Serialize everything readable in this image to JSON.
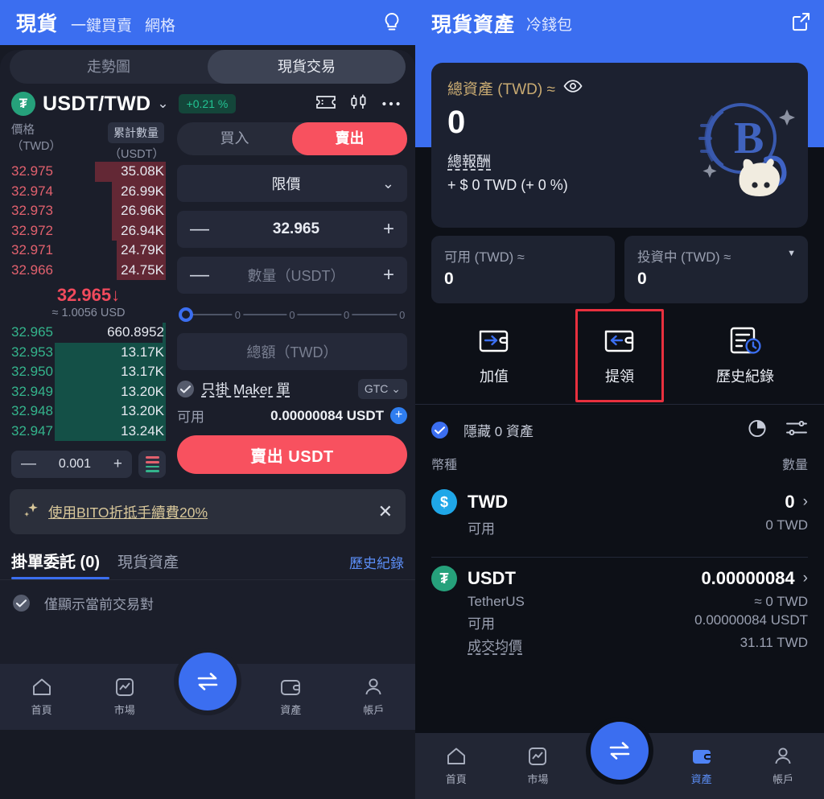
{
  "left": {
    "topbar": {
      "active_tab": "現貨",
      "tabs": [
        "一鍵買賣",
        "網格"
      ],
      "bulb_icon": "lightbulb-icon"
    },
    "segment": {
      "inactive": "走勢圖",
      "active": "現貨交易"
    },
    "pair": {
      "coin_symbol": "₮",
      "name": "USDT/TWD",
      "caret": "⌄",
      "change": "+0.21 %",
      "icons": [
        "ticket-icon",
        "candlestick-icon",
        "more-icon"
      ]
    },
    "orderbook": {
      "head_price": "價格",
      "head_price_unit": "（TWD）",
      "head_qty": "累計數量",
      "head_qty_unit": "（USDT）",
      "asks": [
        {
          "price": "32.975",
          "amount": "35.08K",
          "depth": 46
        },
        {
          "price": "32.974",
          "amount": "26.99K",
          "depth": 35
        },
        {
          "price": "32.973",
          "amount": "26.96K",
          "depth": 35
        },
        {
          "price": "32.972",
          "amount": "26.94K",
          "depth": 35
        },
        {
          "price": "32.971",
          "amount": "24.79K",
          "depth": 32
        },
        {
          "price": "32.966",
          "amount": "24.75K",
          "depth": 32
        }
      ],
      "mid_price": "32.965",
      "mid_arrow": "↓",
      "mid_usd": "≈ 1.0056 USD",
      "bids": [
        {
          "price": "32.965",
          "amount": "660.8952",
          "depth": 2
        },
        {
          "price": "32.953",
          "amount": "13.17K",
          "depth": 72
        },
        {
          "price": "32.950",
          "amount": "13.17K",
          "depth": 72
        },
        {
          "price": "32.949",
          "amount": "13.20K",
          "depth": 72
        },
        {
          "price": "32.948",
          "amount": "13.20K",
          "depth": 72
        },
        {
          "price": "32.947",
          "amount": "13.24K",
          "depth": 72
        }
      ],
      "tick_minus": "—",
      "tick_value": "0.001",
      "tick_plus": "+",
      "depth_icon": "orderbook-layout-icon"
    },
    "form": {
      "buy_tab": "買入",
      "sell_tab": "賣出",
      "order_type": "限價",
      "order_type_caret": "⌄",
      "price_minus": "—",
      "price_value": "32.965",
      "price_plus": "+",
      "qty_minus": "—",
      "qty_placeholder": "數量（USDT）",
      "qty_plus": "+",
      "slider_ticks": [
        "0",
        "0",
        "0",
        "0"
      ],
      "total_placeholder": "總額（TWD）",
      "maker_label": "只掛 Maker 單",
      "maker_checked": true,
      "tif": "GTC",
      "tif_caret": "⌄",
      "avail_label": "可用",
      "avail_value": "0.00000084 USDT",
      "plus_label": "+",
      "submit_label": "賣出 USDT"
    },
    "promo": {
      "icon": "sparkle-icon",
      "text": "使用BITO折抵手續費20%",
      "close": "✕"
    },
    "tabs": {
      "orders": "掛單委託 (0)",
      "spot": "現貨資產",
      "history": "歷史紀錄"
    },
    "filter": {
      "label": "僅顯示當前交易對",
      "checked": true
    },
    "bottom_nav": [
      {
        "icon": "home-icon",
        "label": "首頁",
        "active": false
      },
      {
        "icon": "market-chart-icon",
        "label": "市場",
        "active": false
      },
      {
        "icon": "swap-icon",
        "label": "",
        "active": false
      },
      {
        "icon": "wallet-icon",
        "label": "資產",
        "active": false
      },
      {
        "icon": "account-icon",
        "label": "帳戶",
        "active": false
      }
    ]
  },
  "right": {
    "topbar": {
      "title": "現貨資產",
      "sub": "冷錢包",
      "external_icon": "external-link-icon"
    },
    "total_card": {
      "label": "總資產 (TWD) ≈",
      "eye_icon": "eye-icon",
      "amount": "0",
      "reward_label": "總報酬",
      "reward_value": "+ $ 0 TWD (+ 0 %)"
    },
    "minis": [
      {
        "label": "可用 (TWD) ≈",
        "value": "0",
        "caret": ""
      },
      {
        "label": "投資中 (TWD) ≈",
        "value": "0",
        "caret": "▼"
      }
    ],
    "actions": [
      {
        "icon": "wallet-deposit-icon",
        "label": "加值",
        "highlighted": false
      },
      {
        "icon": "wallet-withdraw-icon",
        "label": "提領",
        "highlighted": true
      },
      {
        "icon": "history-clock-icon",
        "label": "歷史紀錄",
        "highlighted": false
      }
    ],
    "hide_zero": {
      "label": "隱藏 0 資產",
      "checked": true,
      "pie_icon": "pie-chart-icon",
      "filter_icon": "filter-sliders-icon"
    },
    "col_headers": {
      "coin": "幣種",
      "amount": "數量"
    },
    "assets": [
      {
        "badge": "$",
        "badge_class": "twd",
        "symbol": "TWD",
        "amount": "0",
        "chevron": "›",
        "rows": [
          {
            "label": "可用",
            "value": "0 TWD",
            "dashed": false
          }
        ],
        "fullname": ""
      },
      {
        "badge": "₮",
        "badge_class": "usdt",
        "symbol": "USDT",
        "amount": "0.00000084",
        "chevron": "›",
        "fullname": "TetherUS",
        "fullname_value": "≈ 0 TWD",
        "rows": [
          {
            "label": "可用",
            "value": "0.00000084 USDT",
            "dashed": false
          },
          {
            "label": "成交均價",
            "value": "31.11 TWD",
            "dashed": true
          }
        ]
      }
    ],
    "bottom_nav": [
      {
        "icon": "home-icon",
        "label": "首頁",
        "active": false
      },
      {
        "icon": "market-chart-icon",
        "label": "市場",
        "active": false
      },
      {
        "icon": "swap-icon",
        "label": "",
        "active": false
      },
      {
        "icon": "wallet-icon",
        "label": "資產",
        "active": true
      },
      {
        "icon": "account-icon",
        "label": "帳戶",
        "active": false
      }
    ]
  },
  "colors": {
    "brand_blue": "#3b6ef0",
    "sell_red": "#f8515f",
    "buy_green": "#26a17b",
    "ask_red": "#e2616e",
    "bid_green": "#34b48c",
    "gold": "#c9ab72",
    "highlight_box": "#e8303e"
  }
}
